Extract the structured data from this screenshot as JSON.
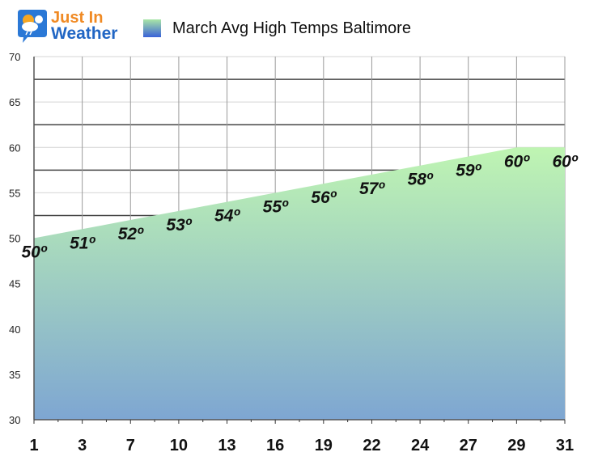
{
  "logo": {
    "line1": "Just In",
    "line2": "Weather",
    "icon": "weather-cloud-sun-snow-icon"
  },
  "legend": {
    "label": "March Avg High Temps Baltimore",
    "swatch_colors": [
      "#a9e6a6",
      "#3a62d8"
    ]
  },
  "chart_data": {
    "type": "area",
    "title": "March Avg High Temps Baltimore",
    "xlabel": "",
    "ylabel": "",
    "categories": [
      "1",
      "3",
      "7",
      "10",
      "13",
      "16",
      "19",
      "22",
      "24",
      "27",
      "29",
      "31"
    ],
    "series": [
      {
        "name": "March Avg High Temps Baltimore",
        "values": [
          50,
          51,
          52,
          53,
          54,
          55,
          56,
          57,
          58,
          59,
          60,
          60
        ],
        "data_labels": [
          "50º",
          "51º",
          "52º",
          "53º",
          "54º",
          "55º",
          "56º",
          "57º",
          "58º",
          "59º",
          "60º",
          "60º"
        ],
        "fill_gradient": [
          "#bff5b2",
          "#7ea6d2"
        ]
      }
    ],
    "ylim": [
      30,
      70
    ],
    "yticks": [
      30,
      35,
      40,
      45,
      50,
      55,
      60,
      65,
      70
    ],
    "grid": true,
    "legend_position": "top"
  }
}
